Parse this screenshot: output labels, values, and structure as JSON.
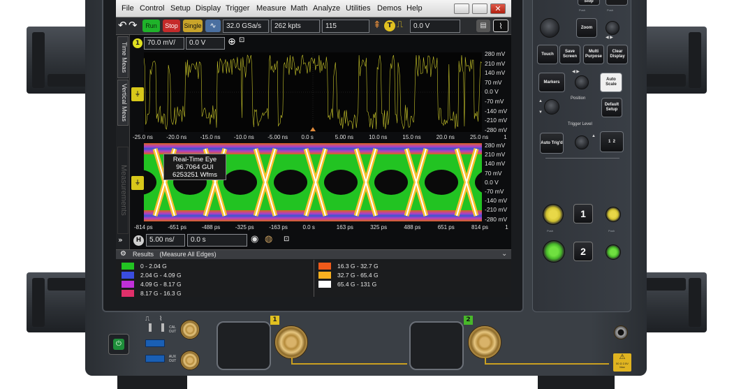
{
  "menu": [
    "File",
    "Control",
    "Setup",
    "Display",
    "Trigger",
    "Measure",
    "Math",
    "Analyze",
    "Utilities",
    "Demos",
    "Help"
  ],
  "toolbar": {
    "run": "Run",
    "stop": "Stop",
    "single": "Single",
    "sample_rate": "32.0 GSa/s",
    "memory_depth": "262 kpts",
    "field_value": "115",
    "trigger_badge": "T",
    "trigger_level": "0.0 V"
  },
  "side_tabs": [
    "Time Meas",
    "Vertical Meas",
    "Measurements"
  ],
  "channel1": {
    "badge": "1",
    "scale": "70.0 mV/",
    "offset": "0.0 V"
  },
  "voltage_ticks": [
    "280 mV",
    "210 mV",
    "140 mV",
    "70 mV",
    "0.0 V",
    "-70 mV",
    "-140 mV",
    "-210 mV",
    "-280 mV"
  ],
  "time_ticks": [
    "-25.0 ns",
    "-20.0 ns",
    "-15.0 ns",
    "-10.0 ns",
    "-5.00 ns",
    "0.0 s",
    "5.00 ns",
    "10.0 ns",
    "15.0 ns",
    "20.0 ns",
    "25.0 ns",
    "1"
  ],
  "eye_time_ticks": [
    "-814 ps",
    "-651 ps",
    "-488 ps",
    "-325 ps",
    "-163 ps",
    "0.0 s",
    "163 ps",
    "325 ps",
    "488 ps",
    "651 ps",
    "814 ps",
    "1"
  ],
  "eye_info": [
    "Real-Time Eye",
    "96.7064 GUI",
    "6253251 Wfms"
  ],
  "horizontal": {
    "badge": "H",
    "scale": "5.00 ns/",
    "position": "0.0 s"
  },
  "results": {
    "title": "Results",
    "subtitle": "(Measure All Edges)",
    "legend_left": [
      {
        "label": "0  - 2.04 G",
        "color": "#22c322"
      },
      {
        "label": "2.04 G - 4.09 G",
        "color": "#3a4de0"
      },
      {
        "label": "4.09 G - 8.17 G",
        "color": "#c030d8"
      },
      {
        "label": "8.17 G - 16.3 G",
        "color": "#e0306a"
      }
    ],
    "legend_right": [
      {
        "label": "16.3 G - 32.7 G",
        "color": "#f05a1a"
      },
      {
        "label": "32.7 G - 65.4 G",
        "color": "#f8b020"
      },
      {
        "label": "65.4 G - 131 G",
        "color": "#ffffff"
      }
    ]
  },
  "panel": {
    "stop": "Stop",
    "zoom": "Zoom",
    "touch": "Touch",
    "save_screen": "Save Screen",
    "multi_purpose": "Multi Purpose",
    "clear_display": "Clear Display",
    "markers": "Markers",
    "auto_scale": "Auto Scale",
    "position": "Position",
    "default_setup": "Default Setup",
    "trigger_level": "Trigger Level",
    "auto_trig": "Auto Trig'd",
    "ch1": "1",
    "ch2": "2"
  },
  "front": {
    "cal_out": "CAL OUT",
    "aux_out": "AUX OUT",
    "input1_badge": "1",
    "input2_badge": "2",
    "warning": "50 Ω 2.5V Max"
  }
}
